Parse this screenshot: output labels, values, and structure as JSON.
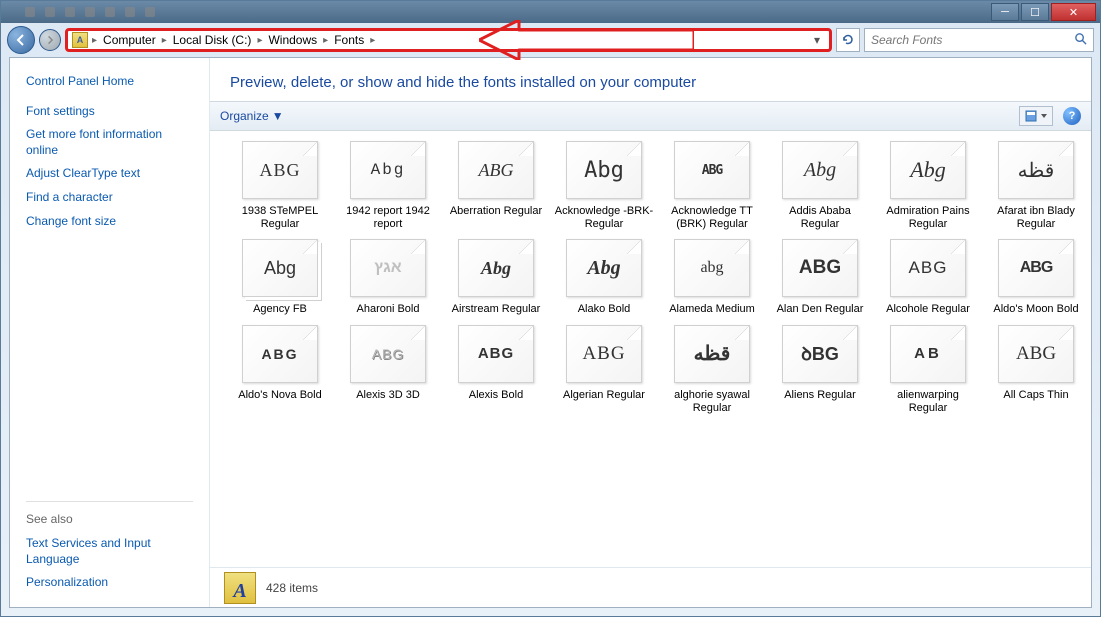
{
  "titlebar_tabs": [
    "",
    "",
    "",
    "",
    "",
    "",
    ""
  ],
  "breadcrumb": [
    "Computer",
    "Local Disk (C:)",
    "Windows",
    "Fonts"
  ],
  "search": {
    "placeholder": "Search Fonts"
  },
  "sidebar": {
    "home": "Control Panel Home",
    "links": [
      "Font settings",
      "Get more font information online",
      "Adjust ClearType text",
      "Find a character",
      "Change font size"
    ],
    "seealso_label": "See also",
    "seealso": [
      "Text Services and Input Language",
      "Personalization"
    ]
  },
  "header": {
    "title": "Preview, delete, or show and hide the fonts installed on your computer"
  },
  "toolbar": {
    "organize": "Organize"
  },
  "fonts": [
    {
      "preview": "ABG",
      "label": "1938 STeMPEL Regular",
      "style": "font-family:serif;letter-spacing:1px"
    },
    {
      "preview": "Abg",
      "label": "1942 report 1942 report",
      "style": "font-family:'Courier New',monospace;font-size:16px;letter-spacing:2px"
    },
    {
      "preview": "ABG",
      "label": "Aberration Regular",
      "style": "font-style:italic;font-family:cursive"
    },
    {
      "preview": "Abg",
      "label": "Acknowledge -BRK- Regular",
      "style": "font-family:monospace;font-size:22px"
    },
    {
      "preview": "ABG",
      "label": "Acknowledge TT (BRK) Regular",
      "style": "font-family:monospace;font-size:13px;font-weight:bold;letter-spacing:-1px"
    },
    {
      "preview": "Abg",
      "label": "Addis Ababa Regular",
      "style": "font-family:cursive;font-style:italic;font-size:20px"
    },
    {
      "preview": "Abg",
      "label": "Admiration Pains Regular",
      "style": "font-family:cursive;font-style:italic;font-size:22px"
    },
    {
      "preview": "قظه",
      "label": "Afarat ibn Blady Regular",
      "style": "font-size:20px"
    },
    {
      "preview": "Abg",
      "label": "Agency FB",
      "style": "font-family:sans-serif;font-stretch:condensed",
      "stack": true
    },
    {
      "preview": "אגץ",
      "label": "Aharoni Bold",
      "style": "font-weight:bold;color:#c0c0c0;font-size:16px"
    },
    {
      "preview": "Abg",
      "label": "Airstream Regular",
      "style": "font-family:cursive;font-weight:bold;font-style:italic"
    },
    {
      "preview": "Abg",
      "label": "Alako Bold",
      "style": "font-family:cursive;font-weight:bold;font-style:italic;font-size:20px"
    },
    {
      "preview": "abg",
      "label": "Alameda Medium",
      "style": "font-family:cursive;font-size:16px"
    },
    {
      "preview": "ABG",
      "label": "Alan Den Regular",
      "style": "font-weight:bold;font-size:19px"
    },
    {
      "preview": "ABG",
      "label": "Alcohole Regular",
      "style": "font-size:17px;font-weight:300;letter-spacing:1px"
    },
    {
      "preview": "ABG",
      "label": "Aldo's Moon Bold",
      "style": "font-weight:900;font-size:16px;letter-spacing:-1px"
    },
    {
      "preview": "ABG",
      "label": "Aldo's Nova Bold",
      "style": "font-weight:900;font-size:14px;font-stretch:expanded;letter-spacing:2px"
    },
    {
      "preview": "ABG",
      "label": "Alexis 3D 3D",
      "style": "color:#b0b0b0;font-size:14px;letter-spacing:1px;text-shadow:1px 1px 0 #888"
    },
    {
      "preview": "ABG",
      "label": "Alexis Bold",
      "style": "font-weight:900;font-size:15px;letter-spacing:1px"
    },
    {
      "preview": "ABG",
      "label": "Algerian Regular",
      "style": "font-family:serif;font-size:19px;letter-spacing:1px"
    },
    {
      "preview": "قظه",
      "label": "alghorie syawal Regular",
      "style": "font-size:20px;font-weight:bold"
    },
    {
      "preview": "ꝺBG",
      "label": "Aliens Regular",
      "style": "font-weight:bold;font-size:18px"
    },
    {
      "preview": "AB",
      "label": "alienwarping Regular",
      "style": "font-weight:900;font-size:15px;letter-spacing:3px"
    },
    {
      "preview": "ABG",
      "label": "All Caps Thin",
      "style": "font-family:cursive;font-size:19px"
    }
  ],
  "status": {
    "count": "428 items"
  }
}
